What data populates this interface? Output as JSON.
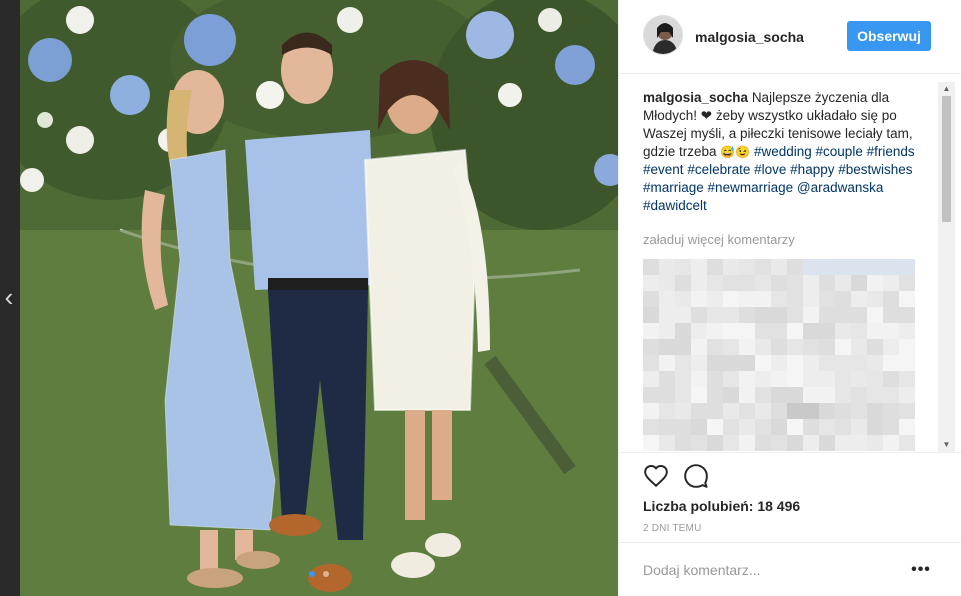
{
  "post": {
    "username": "malgosia_socha",
    "follow_label": "Obserwuj",
    "caption": {
      "user": "malgosia_socha",
      "line1": "Najlepsze życzenia dla Młodych!",
      "heart": "❤",
      "line2": "żeby wszystko układało się po Waszej myśli, a piłeczki tenisowe leciały tam, gdzie trzeba",
      "emoji": "😅😉",
      "tags1": [
        "#wedding",
        "#couple",
        "#friends",
        "#event",
        "#celebrate",
        "#love",
        "#happy",
        "#bestwishes",
        "#marriage",
        "#newmarriage"
      ],
      "mentions": [
        "@aradwanska",
        "#dawidcelt"
      ]
    },
    "load_more": "załaduj więcej komentarzy",
    "likes_text": "Liczba polubień: 18 496",
    "time_text": "2 DNI TEMU",
    "comment_placeholder": "Dodaj komentarz...",
    "more_label": "•••"
  },
  "navigation": {
    "prev_label": "‹"
  },
  "carousel": {
    "count": 2,
    "active_index": 0
  },
  "icons": {
    "like": "heart-outline-icon",
    "comment": "speech-bubble-icon",
    "more": "ellipsis-icon"
  },
  "colors": {
    "accent": "#3897f0",
    "hashtag": "#003569"
  }
}
